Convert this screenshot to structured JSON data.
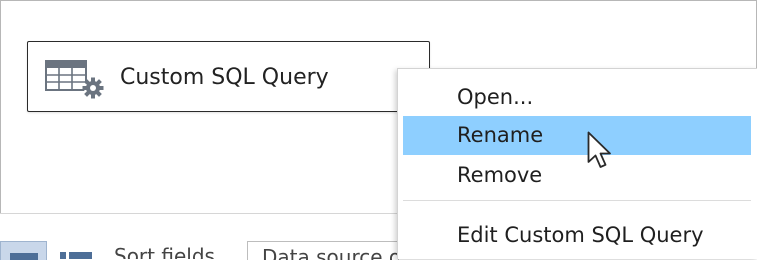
{
  "data_source": {
    "icon": "table-gear-icon",
    "label": "Custom SQL Query"
  },
  "context_menu": {
    "items": [
      {
        "label": "Open...",
        "highlighted": false
      },
      {
        "label": "Rename",
        "highlighted": true
      },
      {
        "label": "Remove",
        "highlighted": false
      },
      {
        "label": "Edit Custom SQL Query",
        "highlighted": false
      }
    ],
    "highlight_color": "#8ecfff"
  },
  "bottom_bar": {
    "sort_label": "Sort fields",
    "sort_value": "Data source order"
  },
  "colors": {
    "accent": "#8ecfff",
    "icon": "#6b7480",
    "selected_view": "#c9d7ea"
  }
}
